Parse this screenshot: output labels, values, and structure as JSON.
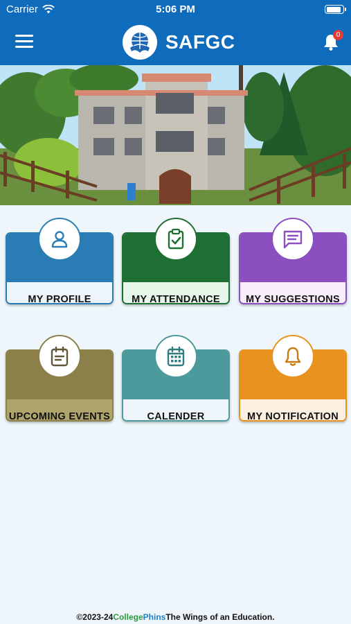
{
  "status_bar": {
    "carrier": "Carrier",
    "time": "5:06 PM"
  },
  "header": {
    "title": "SAFGC",
    "notification_count": "0"
  },
  "colors": {
    "appbar": "#0f6cbd",
    "profile": "#2a7db4",
    "attendance": "#1e6f33",
    "suggestions": "#8b4fbf",
    "events": "#8b7f4a",
    "calender": "#4c9a9c",
    "notification": "#e8931f"
  },
  "tiles": [
    {
      "label": "MY PROFILE",
      "icon": "user-icon"
    },
    {
      "label": "MY ATTENDANCE",
      "icon": "clipboard-check-icon"
    },
    {
      "label": "MY SUGGESTIONS",
      "icon": "message-icon"
    },
    {
      "label": "UPCOMING EVENTS",
      "icon": "note-icon"
    },
    {
      "label": "CALENDER",
      "icon": "calendar-icon"
    },
    {
      "label": "MY NOTIFICATION",
      "icon": "bell-icon"
    }
  ],
  "footer": {
    "prefix": "©2023-24",
    "brand_a": "College",
    "brand_b": "Phins",
    "tagline": "The Wings of an Education."
  }
}
